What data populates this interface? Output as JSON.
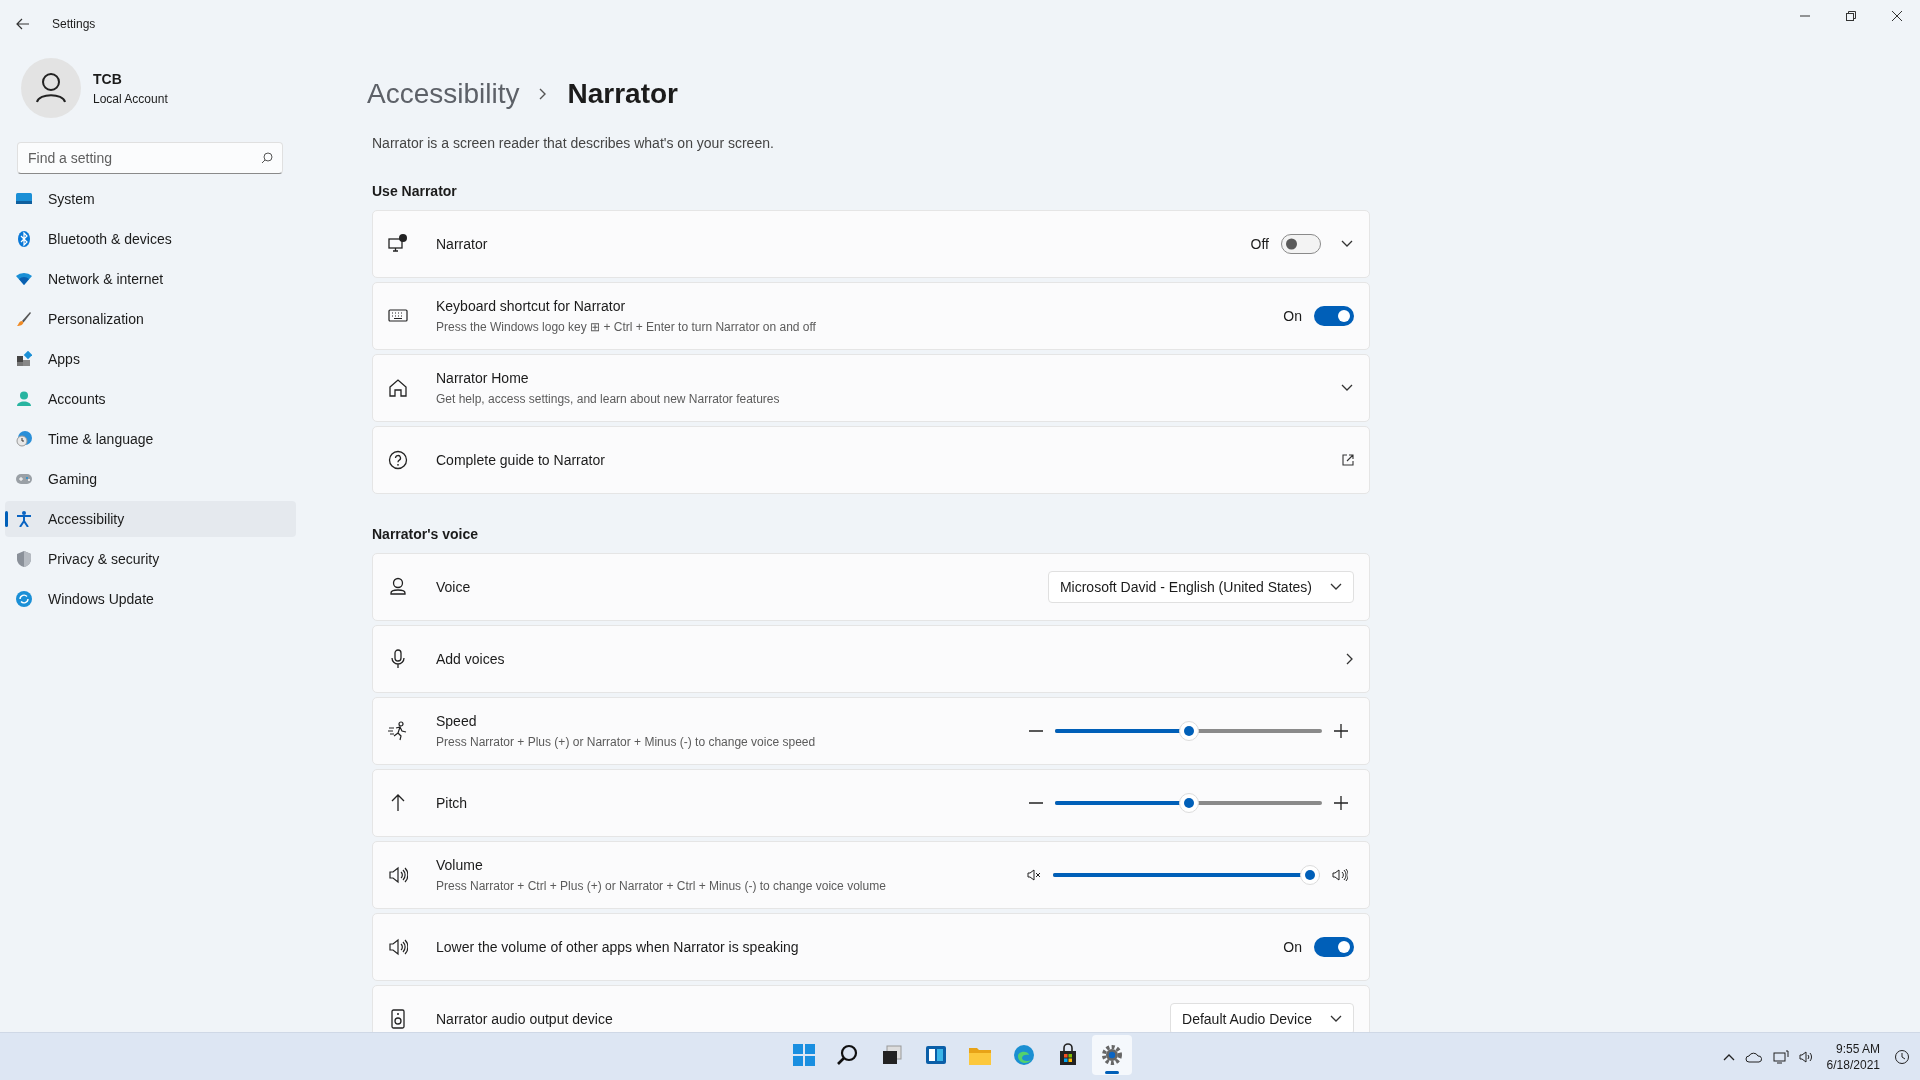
{
  "window": {
    "title": "Settings"
  },
  "profile": {
    "name": "TCB",
    "account": "Local Account"
  },
  "search": {
    "placeholder": "Find a setting"
  },
  "sidebar": {
    "items": [
      {
        "label": "System",
        "selected": false
      },
      {
        "label": "Bluetooth & devices",
        "selected": false
      },
      {
        "label": "Network & internet",
        "selected": false
      },
      {
        "label": "Personalization",
        "selected": false
      },
      {
        "label": "Apps",
        "selected": false
      },
      {
        "label": "Accounts",
        "selected": false
      },
      {
        "label": "Time & language",
        "selected": false
      },
      {
        "label": "Gaming",
        "selected": false
      },
      {
        "label": "Accessibility",
        "selected": true
      },
      {
        "label": "Privacy & security",
        "selected": false
      },
      {
        "label": "Windows Update",
        "selected": false
      }
    ]
  },
  "breadcrumb": [
    "Accessibility",
    "Narrator"
  ],
  "description": "Narrator is a screen reader that describes what's on your screen.",
  "sections": [
    {
      "title": "Use Narrator",
      "cards": [
        {
          "kind": "toggle",
          "title": "Narrator",
          "state_label": "Off",
          "on": false,
          "expandable": true
        },
        {
          "kind": "toggle",
          "title": "Keyboard shortcut for Narrator",
          "subtitle": "Press the Windows logo key ⊞ + Ctrl + Enter to turn Narrator on and off",
          "state_label": "On",
          "on": true,
          "expandable": false
        },
        {
          "kind": "expander",
          "title": "Narrator Home",
          "subtitle": "Get help, access settings, and learn about new Narrator features"
        },
        {
          "kind": "link",
          "title": "Complete guide to Narrator"
        }
      ]
    },
    {
      "title": "Narrator's voice",
      "cards": [
        {
          "kind": "dropdown",
          "title": "Voice",
          "value": "Microsoft David - English (United States)"
        },
        {
          "kind": "nav",
          "title": "Add voices"
        },
        {
          "kind": "slider",
          "title": "Speed",
          "subtitle": "Press Narrator + Plus (+) or Narrator + Minus (-) to change voice speed",
          "level": 0.5
        },
        {
          "kind": "slider",
          "title": "Pitch",
          "level": 0.5
        },
        {
          "kind": "slider",
          "title": "Volume",
          "subtitle": "Press Narrator + Ctrl + Plus (+) or Narrator + Ctrl + Minus (-) to change voice volume",
          "level": 0.97
        },
        {
          "kind": "toggle",
          "title": "Lower the volume of other apps when Narrator is speaking",
          "state_label": "On",
          "on": true,
          "expandable": false
        },
        {
          "kind": "dropdown",
          "title": "Narrator audio output device",
          "value": "Default Audio Device"
        }
      ]
    }
  ],
  "taskbar": {
    "apps": [
      {
        "selected": false
      },
      {
        "selected": false
      },
      {
        "selected": false
      },
      {
        "selected": false
      },
      {
        "selected": false
      },
      {
        "selected": false
      },
      {
        "selected": false
      },
      {
        "selected": true
      }
    ],
    "time": "9:55 AM",
    "date": "6/18/2021"
  }
}
